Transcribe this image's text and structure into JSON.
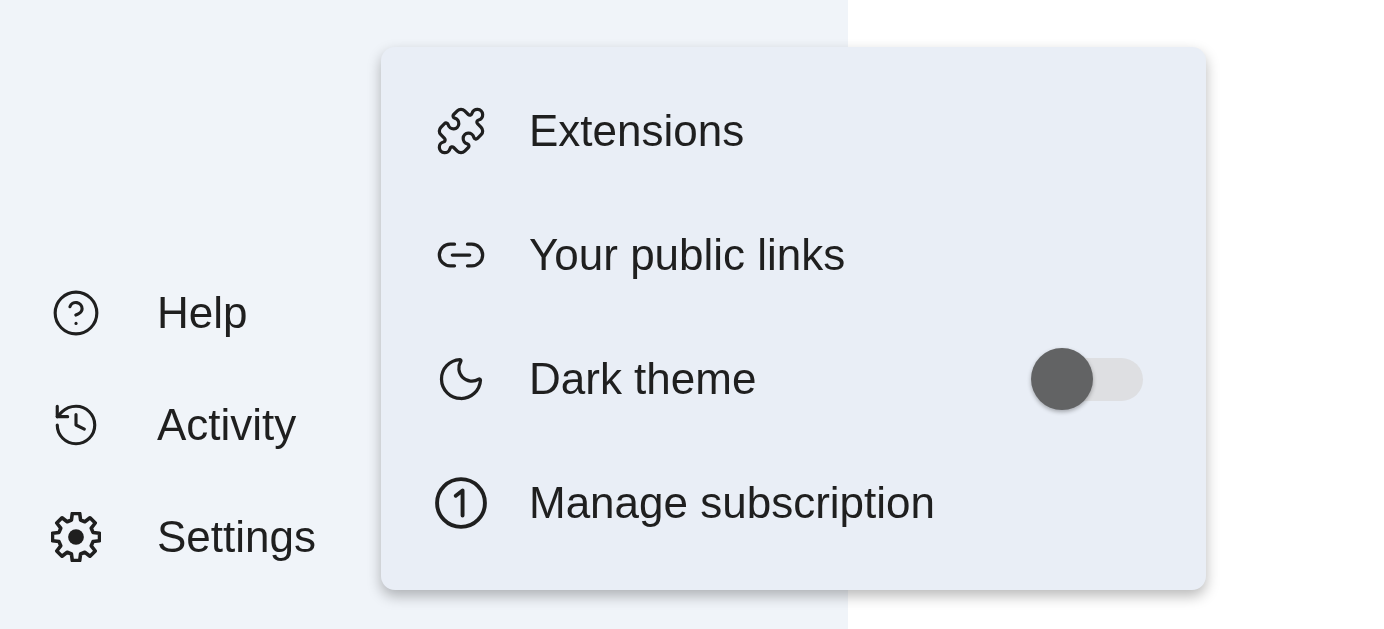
{
  "sidebar": {
    "items": [
      {
        "label": "Help"
      },
      {
        "label": "Activity"
      },
      {
        "label": "Settings"
      }
    ]
  },
  "menu": {
    "items": [
      {
        "label": "Extensions",
        "kind": "link"
      },
      {
        "label": "Your public links",
        "kind": "link"
      },
      {
        "label": "Dark theme",
        "kind": "toggle",
        "on": false
      },
      {
        "label": "Manage subscription",
        "kind": "link"
      }
    ]
  }
}
